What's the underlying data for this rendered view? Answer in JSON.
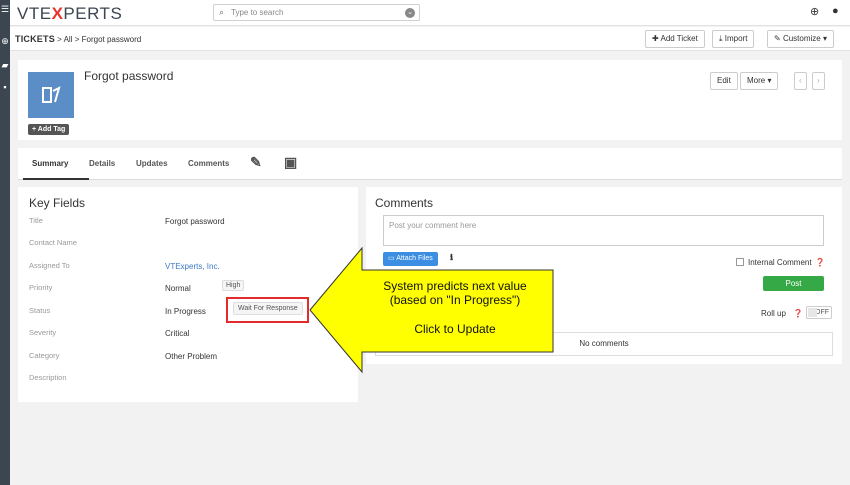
{
  "header": {
    "logo_left": "VTE",
    "logo_x": "X",
    "logo_right": "PERTS",
    "search_placeholder": "Type to search"
  },
  "breadcrumb": {
    "module": "TICKETS",
    "sep1": ">",
    "filter": "All",
    "sep2": ">",
    "record": "Forgot password"
  },
  "actions": {
    "add_ticket": "Add Ticket",
    "import": "Import",
    "customize": "Customize"
  },
  "record": {
    "title": "Forgot password",
    "add_tag": "+ Add Tag",
    "edit": "Edit",
    "more": "More"
  },
  "tabs": [
    {
      "label": "Summary"
    },
    {
      "label": "Details"
    },
    {
      "label": "Updates"
    },
    {
      "label": "Comments"
    }
  ],
  "key_fields": {
    "title": "Key Fields",
    "rows": [
      {
        "label": "Title",
        "value": "Forgot password"
      },
      {
        "label": "Contact Name",
        "value": ""
      },
      {
        "label": "Assigned To",
        "value": "VTExperts, Inc."
      },
      {
        "label": "Priority",
        "value": "Normal"
      },
      {
        "label": "Status",
        "value": "In Progress"
      },
      {
        "label": "Severity",
        "value": "Critical"
      },
      {
        "label": "Category",
        "value": "Other Problem"
      },
      {
        "label": "Description",
        "value": ""
      }
    ],
    "priority_suggestion": "High",
    "status_suggestion": "Wait For Response"
  },
  "comments": {
    "title": "Comments",
    "placeholder": "Post your comment here",
    "attach": "Attach Files",
    "internal": "Internal Comment",
    "post": "Post",
    "rollup": "Roll up",
    "toggle": "OFF",
    "empty": "No comments"
  },
  "annotation": {
    "line1": "System predicts next value",
    "line2": "(based on \"In Progress\")",
    "line3": "Click to Update",
    "arrow_color": "#ffff00",
    "box_color": "#e42b2b"
  }
}
